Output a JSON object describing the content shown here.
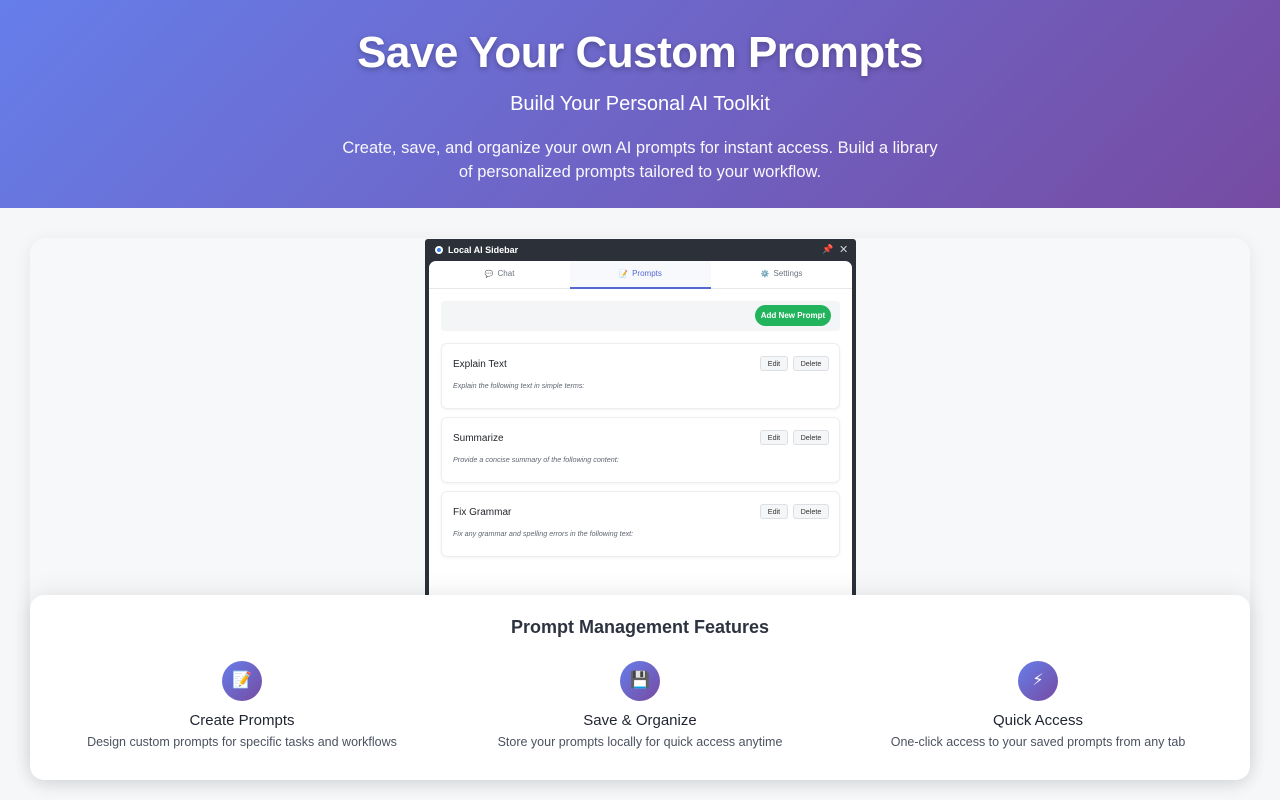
{
  "hero": {
    "title": "Save Your Custom Prompts",
    "subtitle": "Build Your Personal AI Toolkit",
    "description": "Create, save, and organize your own AI prompts for instant access. Build a library of personalized prompts tailored to your workflow."
  },
  "sidebar": {
    "window_title": "Local AI Sidebar",
    "pin_icon": "📌",
    "close_icon": "✕",
    "tabs": [
      {
        "icon": "💬",
        "label": "Chat"
      },
      {
        "icon": "📝",
        "label": "Prompts",
        "active": true
      },
      {
        "icon": "⚙️",
        "label": "Settings"
      }
    ],
    "add_button": "Add New Prompt",
    "prompts": [
      {
        "name": "Explain Text",
        "text": "Explain the following text in simple terms:",
        "edit": "Edit",
        "delete": "Delete"
      },
      {
        "name": "Summarize",
        "text": "Provide a concise summary of the following content:",
        "edit": "Edit",
        "delete": "Delete"
      },
      {
        "name": "Fix Grammar",
        "text": "Fix any grammar and spelling errors in the following text:",
        "edit": "Edit",
        "delete": "Delete"
      }
    ]
  },
  "features": {
    "title": "Prompt Management Features",
    "items": [
      {
        "icon": "📝",
        "icon_name": "memo-icon",
        "title": "Create Prompts",
        "desc": "Design custom prompts for specific tasks and workflows"
      },
      {
        "icon": "💾",
        "icon_name": "floppy-disk-icon",
        "title": "Save & Organize",
        "desc": "Store your prompts locally for quick access anytime"
      },
      {
        "icon": "⚡",
        "icon_name": "lightning-icon",
        "title": "Quick Access",
        "desc": "One-click access to your saved prompts from any tab"
      }
    ]
  },
  "colors": {
    "gradient_start": "#667eea",
    "gradient_end": "#764ba2",
    "active_tab": "#5468d4",
    "add_button": "#22b45c"
  }
}
